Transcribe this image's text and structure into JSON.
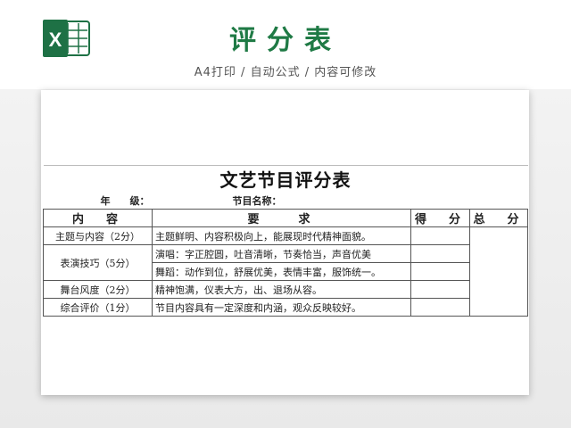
{
  "header": {
    "title": "评分表",
    "subtitle": "A4打印 / 自动公式 / 内容可修改",
    "logo_icon": "excel-icon",
    "logo_letter": "X"
  },
  "colors": {
    "brand_green": "#1f7a45",
    "logo_green": "#1e7145"
  },
  "sheet": {
    "title": "文艺节目评分表",
    "grade_label": "年　　级：",
    "program_label": "节目名称：",
    "headers": {
      "content": "内　容",
      "requirement": "要　　求",
      "score": "得　分",
      "total": "总　分"
    },
    "rows": [
      {
        "category": "主题与内容（2分）",
        "requirement": "主题鲜明、内容积极向上，能展现时代精神面貌。"
      },
      {
        "category": "表演技巧（5分）",
        "requirement": "演唱：字正腔圆，吐音清晰，节奏恰当，声音优美"
      },
      {
        "category": "",
        "requirement": "舞蹈：动作到位，舒展优美，表情丰富，服饰统一。"
      },
      {
        "category": "舞台风度（2分）",
        "requirement": "精神饱满，仪表大方，出、退场从容。"
      },
      {
        "category": "综合评价（1分）",
        "requirement": "节目内容具有一定深度和内涵，观众反映较好。"
      }
    ]
  }
}
